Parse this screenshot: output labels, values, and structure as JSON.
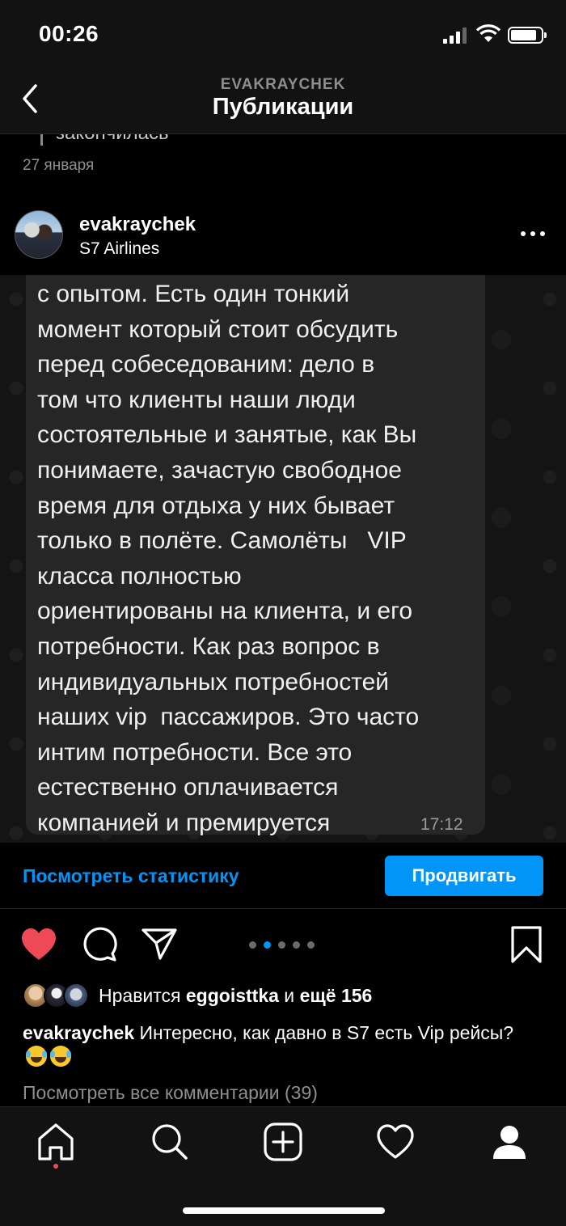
{
  "status_bar": {
    "time": "00:26"
  },
  "header": {
    "account": "EVAKRAYCHEK",
    "title": "Публикации"
  },
  "previous_post": {
    "text_fragment": "закончилась",
    "date": "27 января"
  },
  "post": {
    "username": "evakraychek",
    "location": "S7 Airlines",
    "image": {
      "message_text": "с опытом. Есть один тонкий\nмомент который стоит обсудить\nперед собеседованим: дело в\nтом что клиенты наши люди\nсостоятельные и занятые, как Вы\nпонимаете, зачастую свободное\nвремя для отдыха у них бывает\nтолько в полёте. Самолёты   VIP\nкласса полностью\nориентированы на клиента, и его\nпотребности. Как раз вопрос в\nиндивидуальных потребностей\nнаших vip  пассажиров. Это часто\nинтим потребности. Все это\nестественно оплачивается\nкомпанией и премируется",
      "message_time": "17:12"
    },
    "stats_link": "Посмотреть статистику",
    "promote_button": "Продвигать",
    "carousel": {
      "total": 5,
      "active": 2
    },
    "likes": {
      "prefix": "Нравится ",
      "user": "eggoisttka",
      "middle": " и ",
      "count_text": "ещё 156"
    },
    "caption": {
      "username": "evakraychek",
      "text": " Интересно, как давно в S7 есть Vip рейсы?"
    },
    "view_comments": "Посмотреть все комментарии (39)"
  },
  "icons": {
    "like": "heart-filled-icon",
    "comment": "comment-icon",
    "share": "paper-plane-icon",
    "save": "bookmark-icon",
    "tabs": [
      "home-icon",
      "search-icon",
      "add-post-icon",
      "activity-heart-icon",
      "profile-icon"
    ]
  },
  "colors": {
    "accent": "#0095f6",
    "like": "#ed4956",
    "background": "#000000",
    "bubble": "#262626"
  }
}
